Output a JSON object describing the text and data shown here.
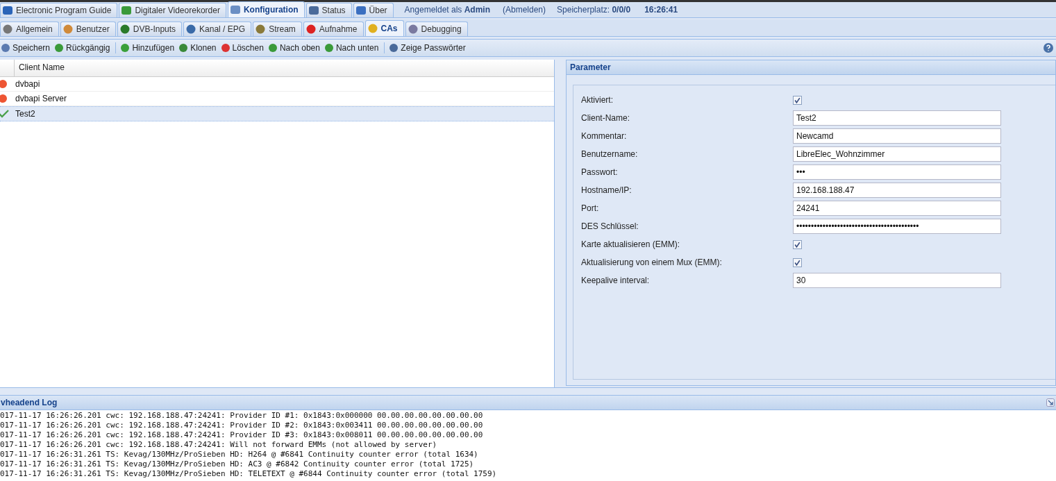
{
  "main_tabs": [
    {
      "label": "Electronic Program Guide",
      "selected": false
    },
    {
      "label": "Digitaler Videorekorder",
      "selected": false
    },
    {
      "label": "Konfiguration",
      "selected": true
    },
    {
      "label": "Status",
      "selected": false
    },
    {
      "label": "Über",
      "selected": false
    }
  ],
  "login": {
    "prefix": "Angemeldet als",
    "user": "Admin",
    "logout": "(Abmelden)"
  },
  "storage": {
    "label": "Speicherplatz:",
    "value": "0/0/0"
  },
  "time": "16:26:41",
  "sub_tabs": [
    {
      "label": "Allgemein",
      "selected": false
    },
    {
      "label": "Benutzer",
      "selected": false
    },
    {
      "label": "DVB-Inputs",
      "selected": false
    },
    {
      "label": "Kanal / EPG",
      "selected": false
    },
    {
      "label": "Stream",
      "selected": false
    },
    {
      "label": "Aufnahme",
      "selected": false
    },
    {
      "label": "CAs",
      "selected": true
    },
    {
      "label": "Debugging",
      "selected": false
    }
  ],
  "toolbar": [
    "Speichern",
    "Rückgängig",
    "Hinzufügen",
    "Klonen",
    "Löschen",
    "Nach oben",
    "Nach unten",
    "Zeige Passwörter"
  ],
  "client_table": {
    "column": "Client Name",
    "rows": [
      {
        "name": "dvbapi",
        "kind": "error",
        "selected": false
      },
      {
        "name": "dvbapi Server",
        "kind": "error",
        "selected": false
      },
      {
        "name": "Test2",
        "kind": "ok",
        "selected": true
      }
    ]
  },
  "parameter_panel": {
    "title": "Parameter",
    "fields": [
      {
        "label": "Aktiviert:",
        "kind": "checkbox",
        "checked": true
      },
      {
        "label": "Client-Name:",
        "kind": "text",
        "value": "Test2"
      },
      {
        "label": "Kommentar:",
        "kind": "text",
        "value": "Newcamd"
      },
      {
        "label": "Benutzername:",
        "kind": "text",
        "value": "LibreElec_Wohnzimmer"
      },
      {
        "label": "Passwort:",
        "kind": "text",
        "value": "•••"
      },
      {
        "label": "Hostname/IP:",
        "kind": "text",
        "value": "192.168.188.47"
      },
      {
        "label": "Port:",
        "kind": "text",
        "value": "24241"
      },
      {
        "label": "DES Schlüssel:",
        "kind": "text",
        "value": "••••••••••••••••••••••••••••••••••••••••••"
      },
      {
        "label": "Karte aktualisieren (EMM):",
        "kind": "checkbox",
        "checked": true
      },
      {
        "label": "Aktualisierung von einem Mux (EMM):",
        "kind": "checkbox",
        "checked": true
      },
      {
        "label": "Keepalive interval:",
        "kind": "text",
        "value": "30"
      }
    ]
  },
  "log": {
    "title": "vheadend Log",
    "lines": [
      "017-11-17 16:26:26.201 cwc: 192.168.188.47:24241: Provider ID #1: 0x1843:0x000000 00.00.00.00.00.00.00.00",
      "017-11-17 16:26:26.201 cwc: 192.168.188.47:24241: Provider ID #2: 0x1843:0x003411 00.00.00.00.00.00.00.00",
      "017-11-17 16:26:26.201 cwc: 192.168.188.47:24241: Provider ID #3: 0x1843:0x008011 00.00.00.00.00.00.00.00",
      "017-11-17 16:26:26.201 cwc: 192.168.188.47:24241: Will not forward EMMs (not allowed by server)",
      "017-11-17 16:26:31.261 TS: Kevag/130MHz/ProSieben HD: H264 @ #6841 Continuity counter error (total 1634)",
      "017-11-17 16:26:31.261 TS: Kevag/130MHz/ProSieben HD: AC3 @ #6842 Continuity counter error (total 1725)",
      "017-11-17 16:26:31.261 TS: Kevag/130MHz/ProSieben HD: TELETEXT @ #6844 Continuity counter error (total 1759)"
    ]
  }
}
